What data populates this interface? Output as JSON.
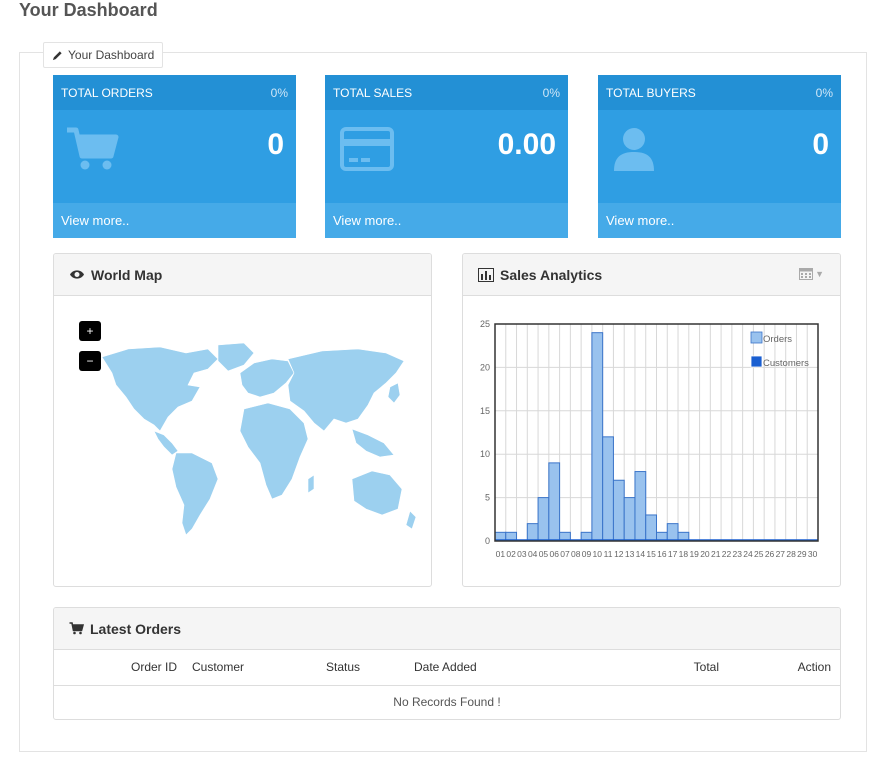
{
  "page": {
    "title": "Your Dashboard"
  },
  "fieldset": {
    "legend": "Your Dashboard",
    "legend_icon": "pencil-icon"
  },
  "tiles": [
    {
      "title": "TOTAL ORDERS",
      "percent": "0%",
      "value": "0",
      "link": "View more..",
      "icon": "shopping-cart-icon"
    },
    {
      "title": "TOTAL SALES",
      "percent": "0%",
      "value": "0.00",
      "link": "View more..",
      "icon": "credit-card-icon"
    },
    {
      "title": "TOTAL BUYERS",
      "percent": "0%",
      "value": "0",
      "link": "View more..",
      "icon": "user-icon"
    }
  ],
  "world_map": {
    "title": "World Map",
    "icon": "eye-icon",
    "zoom_in": "+",
    "zoom_out": "−"
  },
  "analytics": {
    "title": "Sales Analytics",
    "icon": "bar-chart-icon",
    "range_icon": "calendar-icon"
  },
  "chart_data": {
    "type": "bar",
    "categories": [
      "01",
      "02",
      "03",
      "04",
      "05",
      "06",
      "07",
      "08",
      "09",
      "10",
      "11",
      "12",
      "13",
      "14",
      "15",
      "16",
      "17",
      "18",
      "19",
      "20",
      "21",
      "22",
      "23",
      "24",
      "25",
      "26",
      "27",
      "28",
      "29",
      "30"
    ],
    "series": [
      {
        "name": "Orders",
        "values": [
          1,
          1,
          0,
          2,
          5,
          9,
          1,
          0,
          1,
          24,
          12,
          7,
          5,
          8,
          3,
          1,
          2,
          1,
          0,
          0,
          0,
          0,
          0,
          0,
          0,
          0,
          0,
          0,
          0,
          0
        ]
      },
      {
        "name": "Customers",
        "values": [
          0,
          0,
          0,
          0,
          0,
          0,
          0,
          0,
          0,
          0,
          0,
          0,
          0,
          0,
          0,
          0,
          0,
          0,
          0,
          0,
          0,
          0,
          0,
          0,
          0,
          0,
          0,
          0,
          0,
          0
        ]
      }
    ],
    "ylim": [
      0,
      25
    ],
    "yticks": [
      "0",
      "5",
      "10",
      "15",
      "20",
      "25"
    ],
    "xtick_labels": [
      "01",
      "02",
      "03",
      "04",
      "05",
      "06",
      "07",
      "08",
      "09",
      "10",
      "11",
      "12",
      "13",
      "14",
      "15",
      "16",
      "17",
      "18",
      "19",
      "20",
      "21",
      "22",
      "23",
      "24",
      "25",
      "26",
      "27",
      "28",
      "29",
      "30"
    ],
    "grid": true,
    "legend": "top-right",
    "colors": {
      "orders_fill": "#99c2ee",
      "orders_stroke": "#3a74c9",
      "customers": "#1a5fd1"
    }
  },
  "latest_orders": {
    "title": "Latest Orders",
    "icon": "shopping-cart-icon",
    "columns": [
      "Order ID",
      "Customer",
      "Status",
      "Date Added",
      "Total",
      "Action"
    ],
    "empty_text": "No Records Found !"
  },
  "colors": {
    "tile_bg": "#2f9ee3",
    "tile_head": "#2390d5",
    "tile_foot": "#45aae8",
    "map_land": "#9cd0ef"
  }
}
